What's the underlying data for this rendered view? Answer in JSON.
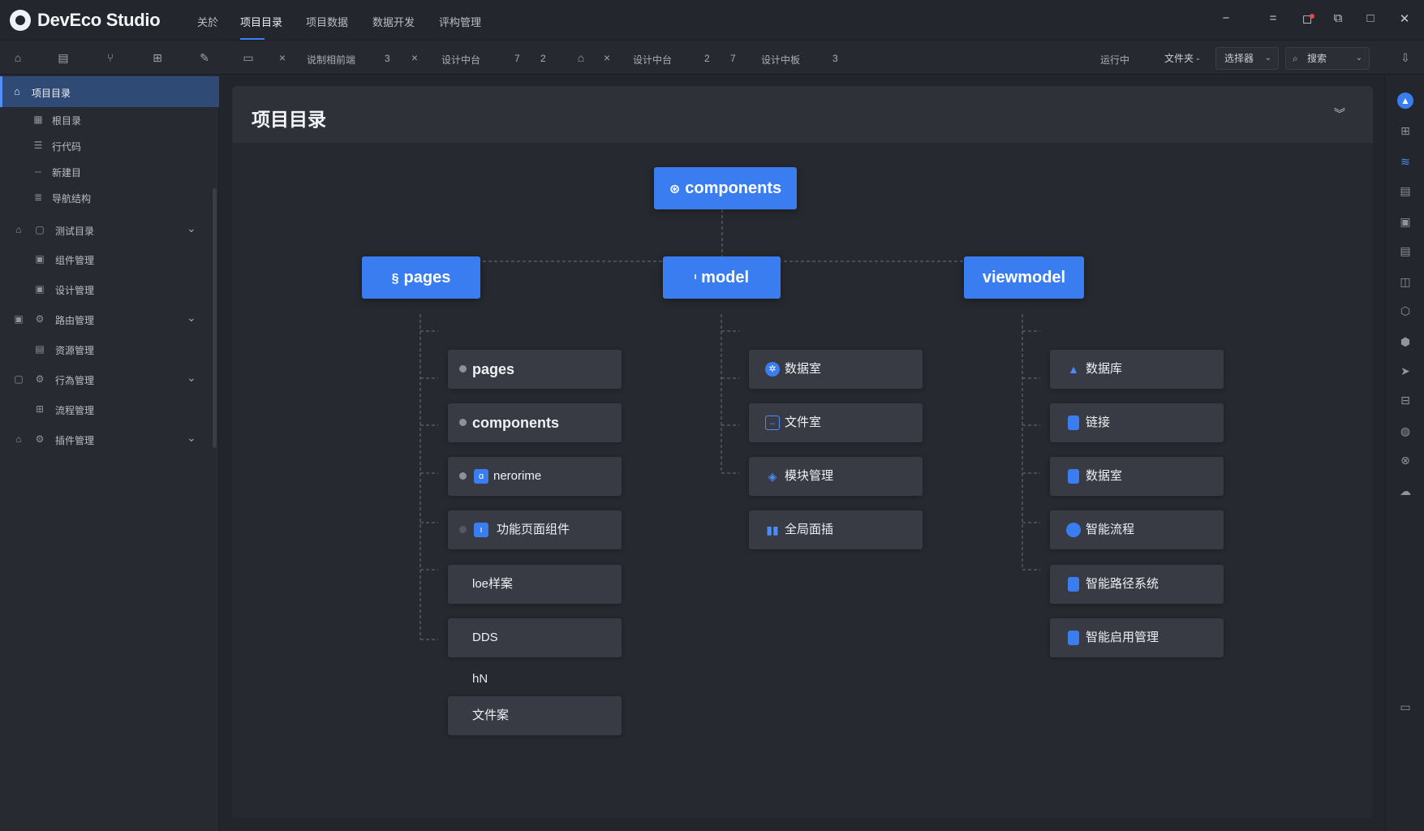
{
  "app": {
    "title": "DevEco Studio"
  },
  "menu": [
    "关於",
    "项目目录",
    "项目数据",
    "数据开发",
    "评构管理"
  ],
  "window_controls": [
    "minimize-line",
    "list",
    "bell",
    "restore",
    "maximize",
    "close"
  ],
  "toolbar": {
    "tabs": [
      {
        "label": "说制相前端",
        "num": "3"
      },
      {
        "label": "设计中台",
        "num": "7",
        "num2": "2"
      },
      {
        "label": "设计中台",
        "num": "2",
        "num2": "7"
      },
      {
        "label": "设计中板",
        "num": "3"
      }
    ],
    "right_label": "运行中",
    "filter_label": "文件夹 -",
    "select_label": "选择器",
    "search_placeholder": "搜索"
  },
  "sidebar": {
    "active": "项目目录",
    "items": [
      {
        "label": "根目录",
        "icon": "grid"
      },
      {
        "label": "行代码",
        "icon": "list"
      },
      {
        "label": "新建目",
        "icon": "dash"
      },
      {
        "label": "导航结构",
        "icon": "stack"
      },
      {
        "label": "测试目录",
        "icon": "folder",
        "expand": "true"
      },
      {
        "label": "组件管理",
        "icon": "doc"
      },
      {
        "label": "设计管理",
        "icon": "doc"
      },
      {
        "label": "路由管理",
        "icon": "gear",
        "expand": "true"
      },
      {
        "label": "资源管理",
        "icon": "file"
      },
      {
        "label": "行為管理",
        "icon": "gear",
        "expand": "true"
      },
      {
        "label": "流程管理",
        "icon": "tree"
      },
      {
        "label": "插件管理",
        "icon": "gear",
        "expand": "true"
      }
    ]
  },
  "main": {
    "title": "项目目录",
    "tree": {
      "root": "components",
      "branches": [
        {
          "label": "pages",
          "children": [
            "pages",
            "components",
            "nerorime",
            "功能页面组件",
            "loe样案",
            "DDS",
            "文件案"
          ]
        },
        {
          "label": "model",
          "children": [
            "数据室",
            "文件室",
            "模块管理",
            "全局面插"
          ]
        },
        {
          "label": "viewmodel",
          "children": [
            "数据库",
            "链接",
            "数据室",
            "智能流程",
            "智能路径系统",
            "智能启用管理"
          ]
        }
      ],
      "loose_label": "hN"
    }
  },
  "colors": {
    "accent": "#3a7df0",
    "background": "#22252c",
    "node": "#383b43"
  }
}
